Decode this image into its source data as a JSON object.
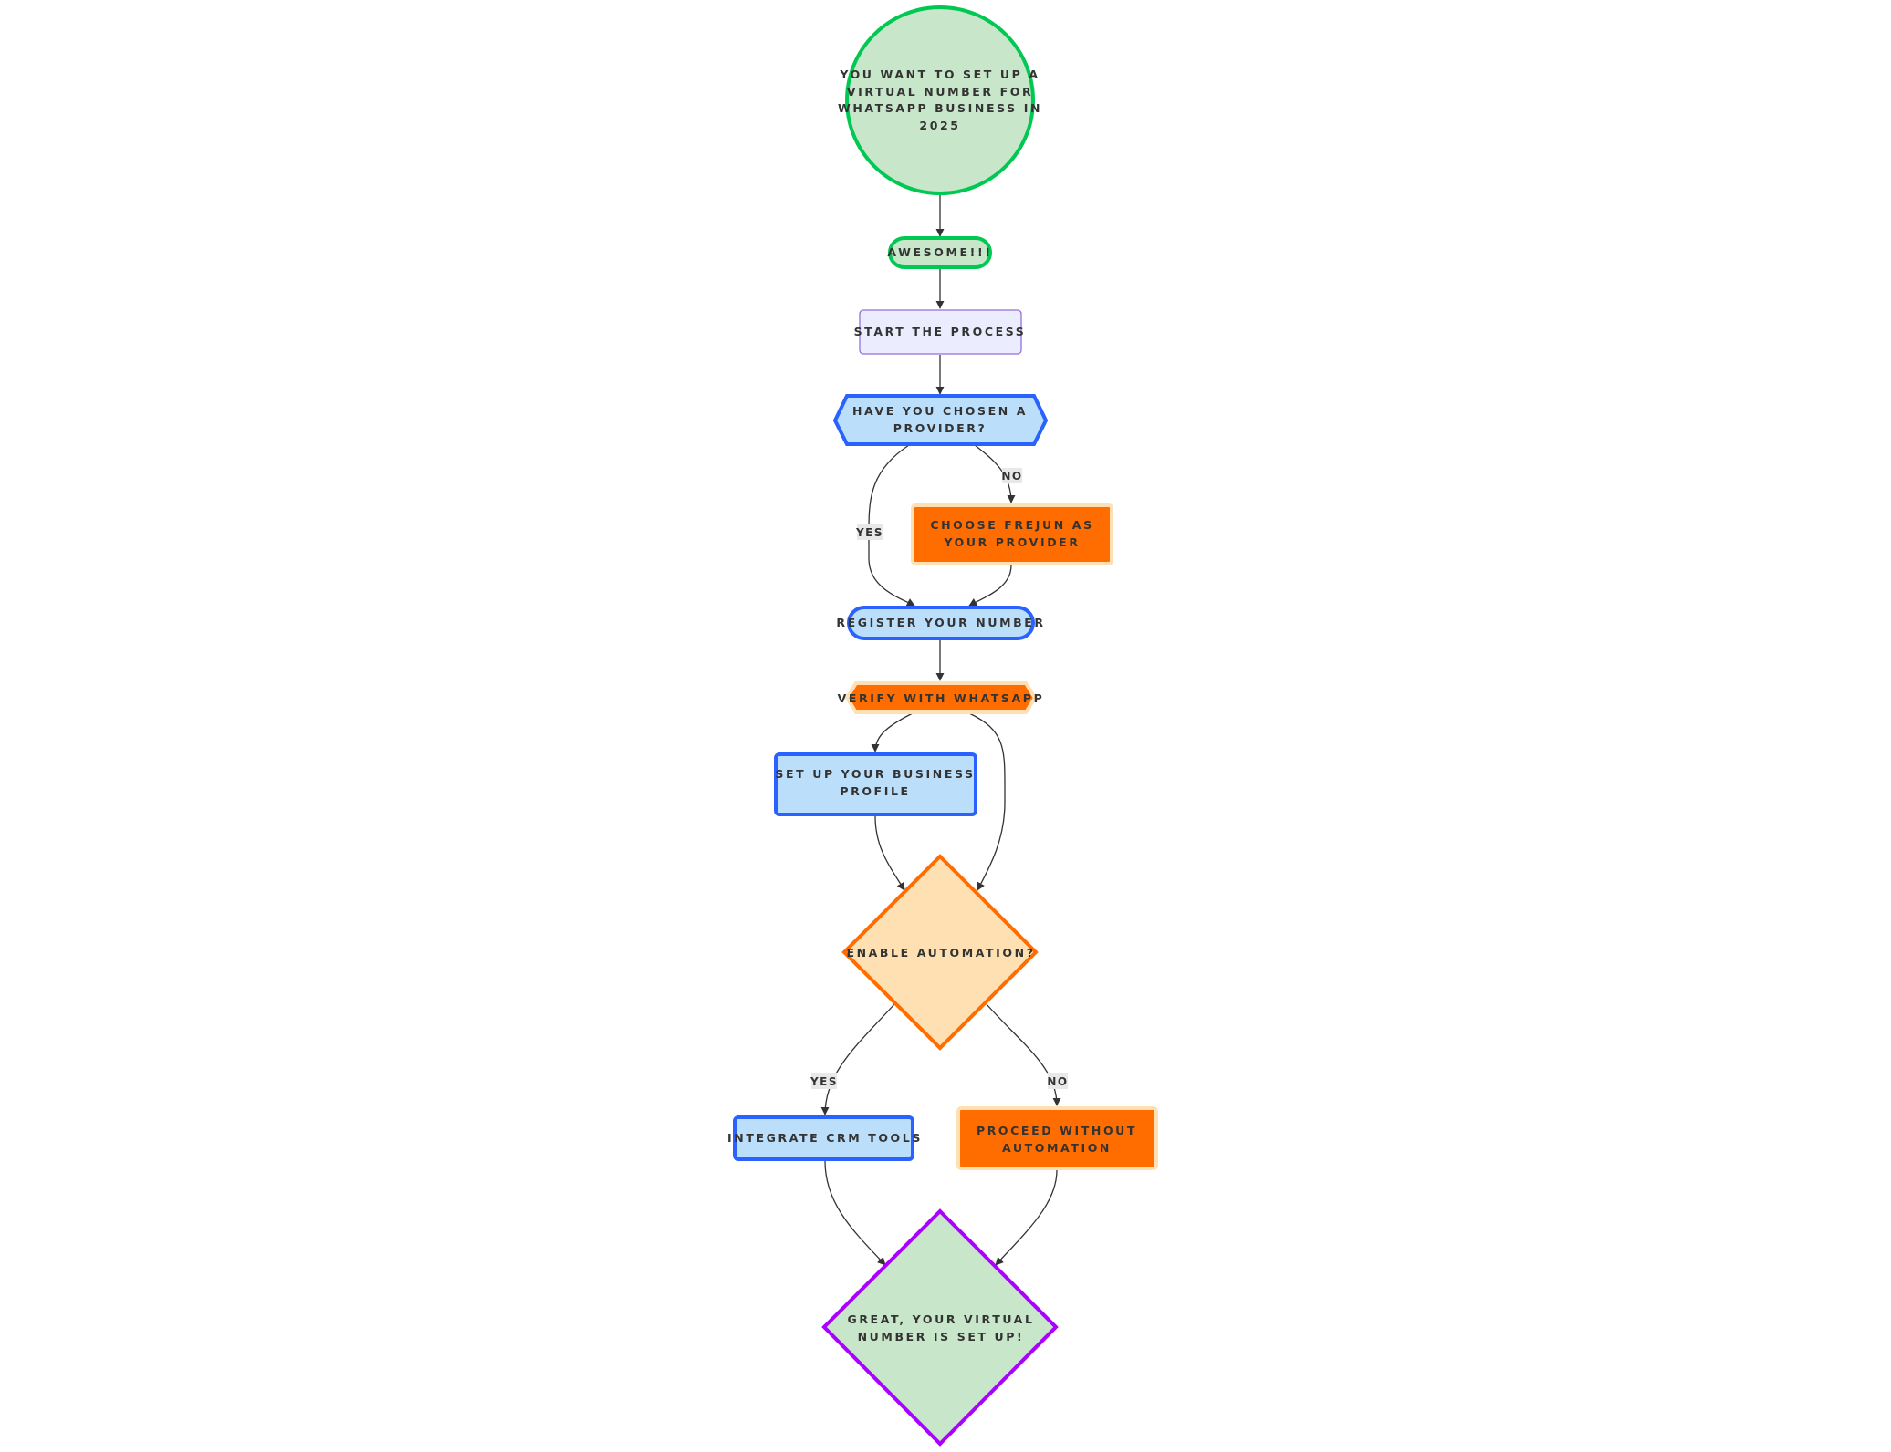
{
  "diagram": {
    "type": "flowchart",
    "colors": {
      "green_fill": "#c8e6c9",
      "green_stroke": "#00c853",
      "lavender_fill": "#ececff",
      "lavender_stroke": "#9370db",
      "blue_fill": "#bbdefb",
      "blue_stroke": "#2962ff",
      "orange_fill": "#ff6d00",
      "orange_stroke": "#ffe0b2",
      "peach_fill": "#ffe0b2",
      "peach_stroke": "#ff6d00",
      "purple_stroke": "#aa00ff",
      "edge": "#333333"
    },
    "nodes": {
      "start_circle": {
        "lines": [
          "YOU WANT TO SET UP A",
          "VIRTUAL NUMBER FOR",
          "WHATSAPP BUSINESS IN",
          "2025"
        ],
        "shape": "circle"
      },
      "awesome": {
        "lines": [
          "AWESOME!!!"
        ],
        "shape": "stadium"
      },
      "start_process": {
        "lines": [
          "START THE PROCESS"
        ],
        "shape": "rect"
      },
      "chosen_provider": {
        "lines": [
          "HAVE YOU CHOSEN A",
          "PROVIDER?"
        ],
        "shape": "hexagon"
      },
      "choose_frejun": {
        "lines": [
          "CHOOSE FREJUN AS",
          "YOUR PROVIDER"
        ],
        "shape": "rect"
      },
      "register": {
        "lines": [
          "REGISTER YOUR NUMBER"
        ],
        "shape": "stadium"
      },
      "verify": {
        "lines": [
          "VERIFY WITH WHATSAPP"
        ],
        "shape": "hexagon"
      },
      "business_profile": {
        "lines": [
          "SET UP YOUR BUSINESS",
          "PROFILE"
        ],
        "shape": "rect"
      },
      "enable_automation": {
        "lines": [
          "ENABLE AUTOMATION?"
        ],
        "shape": "diamond"
      },
      "integrate_crm": {
        "lines": [
          "INTEGRATE CRM TOOLS"
        ],
        "shape": "rect"
      },
      "proceed_without": {
        "lines": [
          "PROCEED WITHOUT",
          "AUTOMATION"
        ],
        "shape": "rect"
      },
      "final": {
        "lines": [
          "GREAT, YOUR VIRTUAL",
          "NUMBER IS SET UP!"
        ],
        "shape": "diamond"
      }
    },
    "edges": [
      {
        "from": "start_circle",
        "to": "awesome",
        "label": ""
      },
      {
        "from": "awesome",
        "to": "start_process",
        "label": ""
      },
      {
        "from": "start_process",
        "to": "chosen_provider",
        "label": ""
      },
      {
        "from": "chosen_provider",
        "to": "register",
        "label": "YES"
      },
      {
        "from": "chosen_provider",
        "to": "choose_frejun",
        "label": "NO"
      },
      {
        "from": "choose_frejun",
        "to": "register",
        "label": ""
      },
      {
        "from": "register",
        "to": "verify",
        "label": ""
      },
      {
        "from": "verify",
        "to": "business_profile",
        "label": ""
      },
      {
        "from": "verify",
        "to": "enable_automation",
        "label": ""
      },
      {
        "from": "business_profile",
        "to": "enable_automation",
        "label": ""
      },
      {
        "from": "enable_automation",
        "to": "integrate_crm",
        "label": "YES"
      },
      {
        "from": "enable_automation",
        "to": "proceed_without",
        "label": "NO"
      },
      {
        "from": "integrate_crm",
        "to": "final",
        "label": ""
      },
      {
        "from": "proceed_without",
        "to": "final",
        "label": ""
      }
    ]
  }
}
